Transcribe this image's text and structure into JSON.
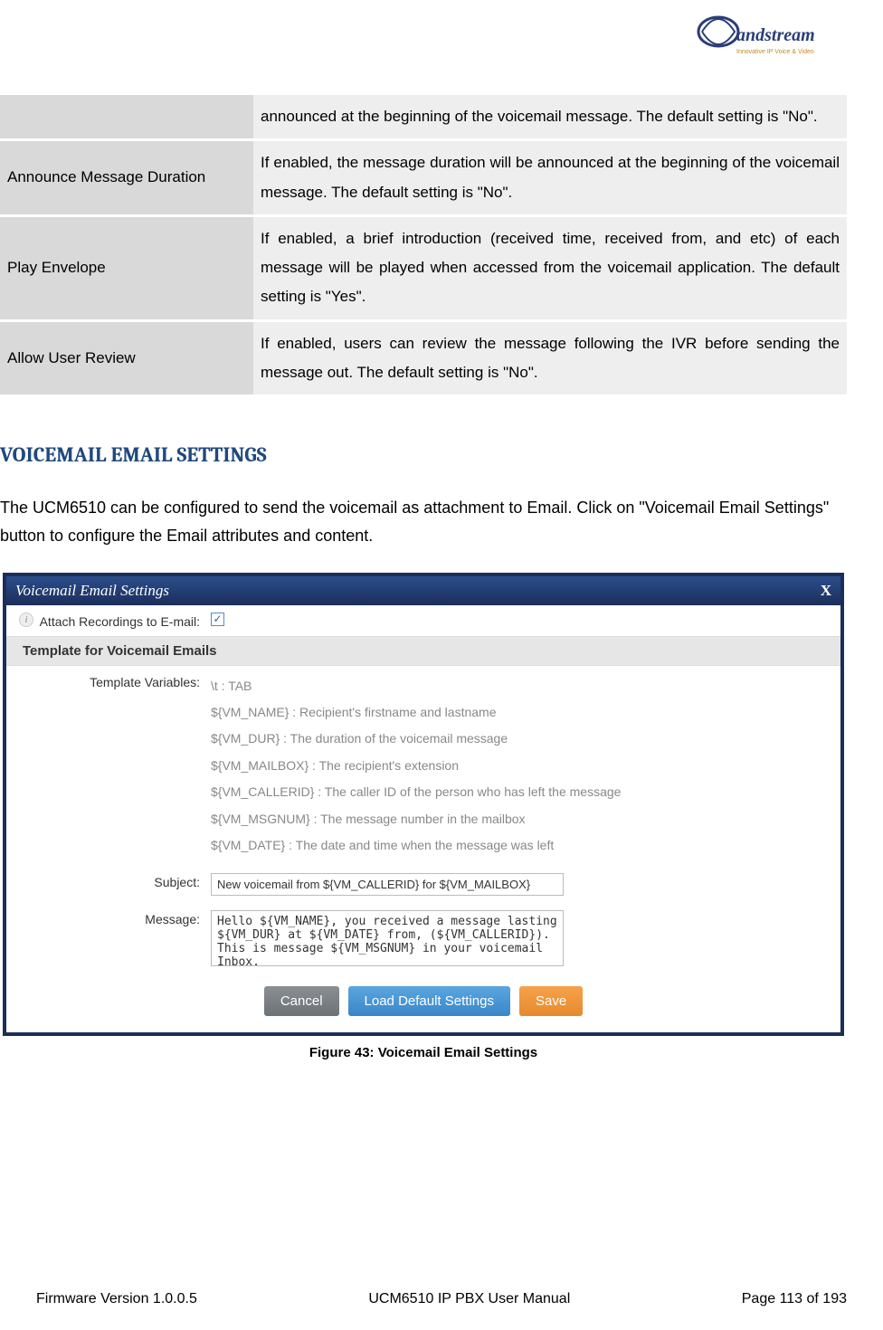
{
  "logo": {
    "brand": "Grandstream",
    "tagline": "Innovative IP Voice & Video"
  },
  "table": {
    "rows": [
      {
        "label": "",
        "desc": "announced at the beginning of the voicemail message. The default setting is \"No\"."
      },
      {
        "label": "Announce Message Duration",
        "desc": "If enabled, the message duration will be announced at the beginning of the voicemail message. The default setting is \"No\"."
      },
      {
        "label": "Play Envelope",
        "desc": "If enabled, a brief introduction (received time, received from, and etc) of each message will be played when accessed from the voicemail application. The default setting is \"Yes\"."
      },
      {
        "label": "Allow User Review",
        "desc": "If enabled, users can review the message following the IVR before sending the message out. The default setting is \"No\"."
      }
    ]
  },
  "section_heading": "VOICEMAIL EMAIL SETTINGS",
  "section_para": "The UCM6510 can be configured to send the voicemail as attachment to Email. Click on \"Voicemail Email Settings\" button to configure the Email attributes and content.",
  "screenshot": {
    "title": "Voicemail Email Settings",
    "close": "X",
    "attach_label": "Attach Recordings to E-mail:",
    "subhead": "Template for Voicemail Emails",
    "tv_label": "Template Variables:",
    "tv_lines": [
      "\\t : TAB",
      "${VM_NAME} : Recipient's firstname and lastname",
      "${VM_DUR} : The duration of the voicemail message",
      "${VM_MAILBOX} : The recipient's extension",
      "${VM_CALLERID} : The caller ID of the person who has left the message",
      "${VM_MSGNUM} : The message number in the mailbox",
      "${VM_DATE} : The date and time when the message was left"
    ],
    "subject_label": "Subject:",
    "subject_value": "New voicemail from ${VM_CALLERID} for ${VM_MAILBOX}",
    "message_label": "Message:",
    "message_value": "Hello ${VM_NAME}, you received a message lasting ${VM_DUR} at ${VM_DATE} from, (${VM_CALLERID}). This is message ${VM_MSGNUM} in your voicemail Inbox.",
    "buttons": {
      "cancel": "Cancel",
      "load": "Load Default Settings",
      "save": "Save"
    }
  },
  "figure_caption": "Figure 43: Voicemail Email Settings",
  "footer": {
    "left": "Firmware Version 1.0.0.5",
    "center": "UCM6510 IP PBX User Manual",
    "right": "Page 113 of 193"
  }
}
